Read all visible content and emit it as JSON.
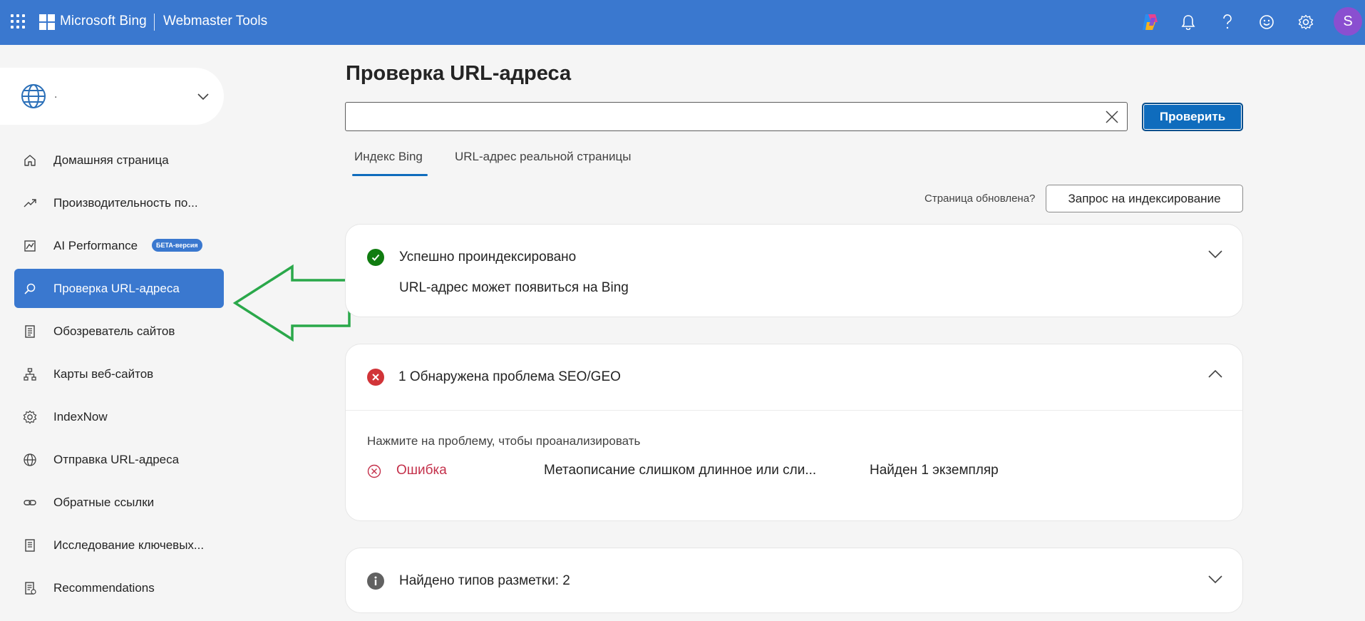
{
  "header": {
    "brand": "Microsoft Bing",
    "product": "Webmaster Tools",
    "avatar_initial": "S",
    "icons": [
      "apps-waffle-icon",
      "copilot-icon",
      "bell-icon",
      "help-icon",
      "feedback-smiley-icon",
      "gear-icon"
    ]
  },
  "site_picker": {
    "site_name": "."
  },
  "sidebar": {
    "items": [
      {
        "label": "Домашняя страница",
        "icon": "home-icon"
      },
      {
        "label": "Производительность по...",
        "icon": "trend-icon"
      },
      {
        "label": "AI Performance",
        "icon": "chart-icon",
        "badge": "БЕТА-версия"
      },
      {
        "label": "Проверка URL-адреса",
        "icon": "search-icon",
        "active": true
      },
      {
        "label": "Обозреватель сайтов",
        "icon": "document-list-icon"
      },
      {
        "label": "Карты веб-сайтов",
        "icon": "sitemap-icon"
      },
      {
        "label": "IndexNow",
        "icon": "gear-icon"
      },
      {
        "label": "Отправка URL-адреса",
        "icon": "globe-icon"
      },
      {
        "label": "Обратные ссылки",
        "icon": "link-icon"
      },
      {
        "label": "Исследование ключевых...",
        "icon": "notebook-icon"
      },
      {
        "label": "Recommendations",
        "icon": "checklist-icon"
      }
    ]
  },
  "main": {
    "title": "Проверка URL-адреса",
    "url_input": {
      "value": "",
      "placeholder": ""
    },
    "check_button": "Проверить",
    "tabs": [
      {
        "label": "Индекс Bing",
        "active": true
      },
      {
        "label": "URL-адрес реальной страницы",
        "active": false
      }
    ],
    "updated_question": "Страница обновлена?",
    "request_index_button": "Запрос на индексирование",
    "cards": {
      "indexed": {
        "title": "Успешно проиндексировано",
        "subtitle": "URL-адрес может появиться на Bing",
        "status_color": "#107c10"
      },
      "seo": {
        "title": "1 Обнаружена проблема SEO/GEO",
        "hint": "Нажмите на проблему, чтобы проанализировать",
        "status_color": "#d13438",
        "issue": {
          "severity": "Ошибка",
          "description": "Метаописание слишком длинное или сли...",
          "count": "Найден 1 экземпляр"
        }
      },
      "markup": {
        "title": "Найдено типов разметки: 2",
        "status_color": "#616161"
      }
    }
  },
  "colors": {
    "header_bg": "#3a78cf",
    "primary": "#0f6cbd",
    "annotation_arrow": "#2aa84a"
  }
}
